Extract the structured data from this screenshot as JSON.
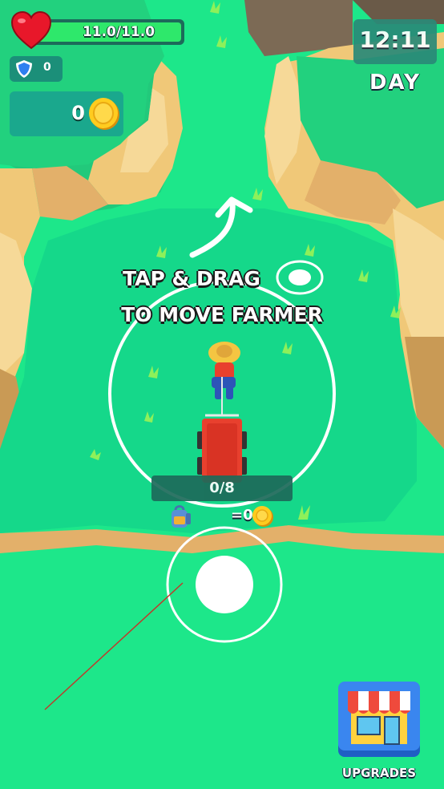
{
  "hud": {
    "health_text": "11.0/11.0",
    "health_fraction": 1.0,
    "shield_count": "0",
    "coins": "0",
    "clock": "12:11",
    "period": "DAY"
  },
  "tutorial": {
    "line1": "TAP & DRAG",
    "line2": "TO MOVE FARMER"
  },
  "cart": {
    "load": "0/8",
    "bag_value": "=0"
  },
  "shop": {
    "label": "UPGRADES"
  },
  "colors": {
    "grass": "#1de78a",
    "field": "#15d88a",
    "rock": "#f0c878",
    "rock_dark": "#c99a55",
    "health": "#2ee86b",
    "cart": "#e8402e"
  }
}
